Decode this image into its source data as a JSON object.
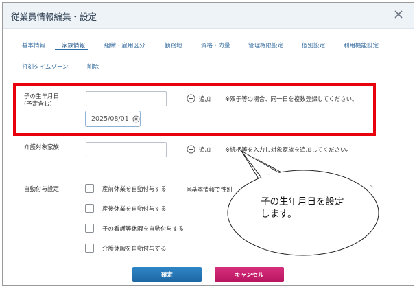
{
  "dialog": {
    "title": "従業員情報編集・設定"
  },
  "tabs": [
    {
      "label": "基本情報"
    },
    {
      "label": "家族情報"
    },
    {
      "label": "組織・雇用区分"
    },
    {
      "label": "勤務地"
    },
    {
      "label": "資格・力量"
    },
    {
      "label": "管理権限設定"
    },
    {
      "label": "個別設定"
    },
    {
      "label": "利用機能設定"
    },
    {
      "label": "打刻タイムゾーン"
    },
    {
      "label": "削除"
    }
  ],
  "active_tab": "家族情報",
  "birthdate": {
    "label_line1": "子の生年月日",
    "label_line2": "(予定含む)",
    "input_value": "",
    "add_label": "追加",
    "note": "※双子等の場合、同一日を複数登録してください。",
    "registered_date": "2025/08/01"
  },
  "care": {
    "label": "介護対象家族",
    "input_value": "",
    "add_label": "追加",
    "note": "※続柄等を入力し対象家族を追加してください。"
  },
  "auto_grant": {
    "label": "自動付与設定",
    "note": "※基本情報で性別",
    "items": [
      {
        "label": "産前休業を自動付与する",
        "checked": false
      },
      {
        "label": "産後休業を自動付与する",
        "checked": false
      },
      {
        "label": "子の看護等休暇を自動付与する",
        "checked": false
      },
      {
        "label": "介護休暇を自動付与する",
        "checked": false
      }
    ]
  },
  "buttons": {
    "ok_label": "確定",
    "cancel_label": "キャンセル"
  },
  "callout": {
    "line1": "子の生年月日を設定",
    "line2": "します。"
  },
  "colors": {
    "highlight": "#e8000d",
    "ok": "#1d66a3",
    "cancel": "#b8155f",
    "tab_link": "#3a6fa0"
  }
}
